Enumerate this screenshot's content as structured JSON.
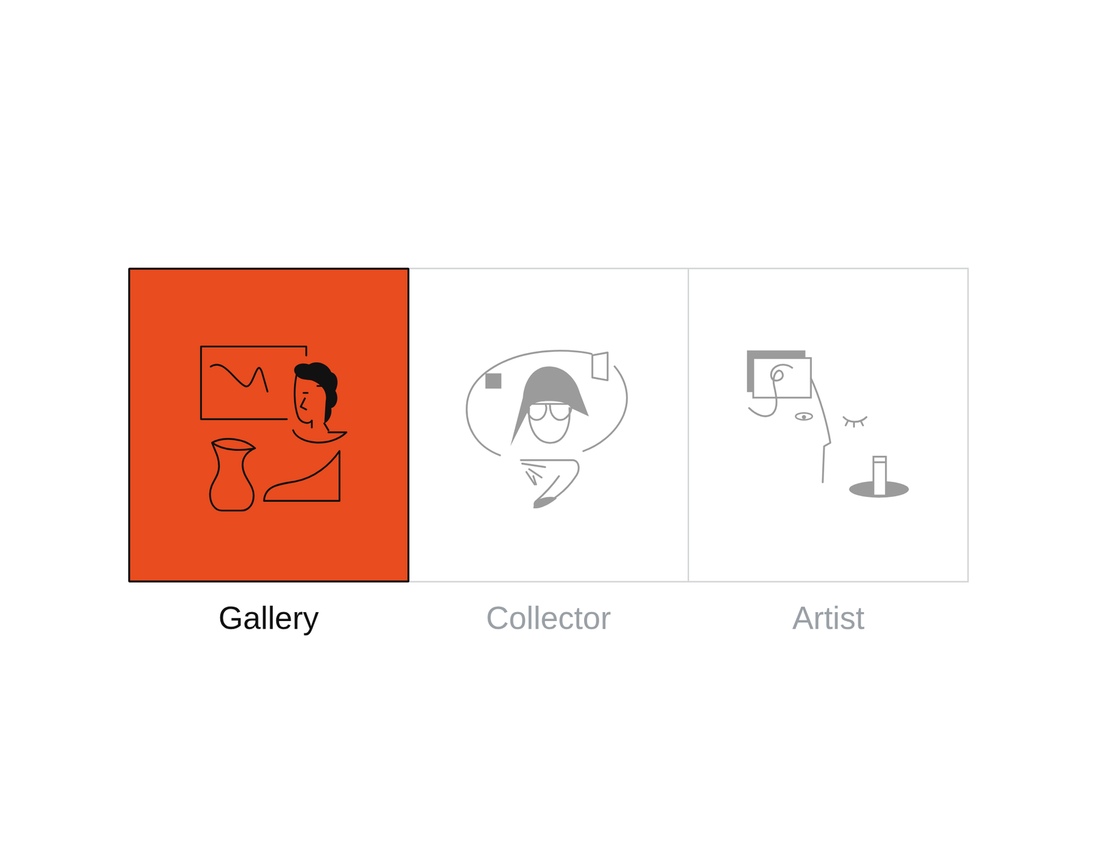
{
  "options": [
    {
      "label": "Gallery",
      "selected": true
    },
    {
      "label": "Collector",
      "selected": false
    },
    {
      "label": "Artist",
      "selected": false
    }
  ]
}
